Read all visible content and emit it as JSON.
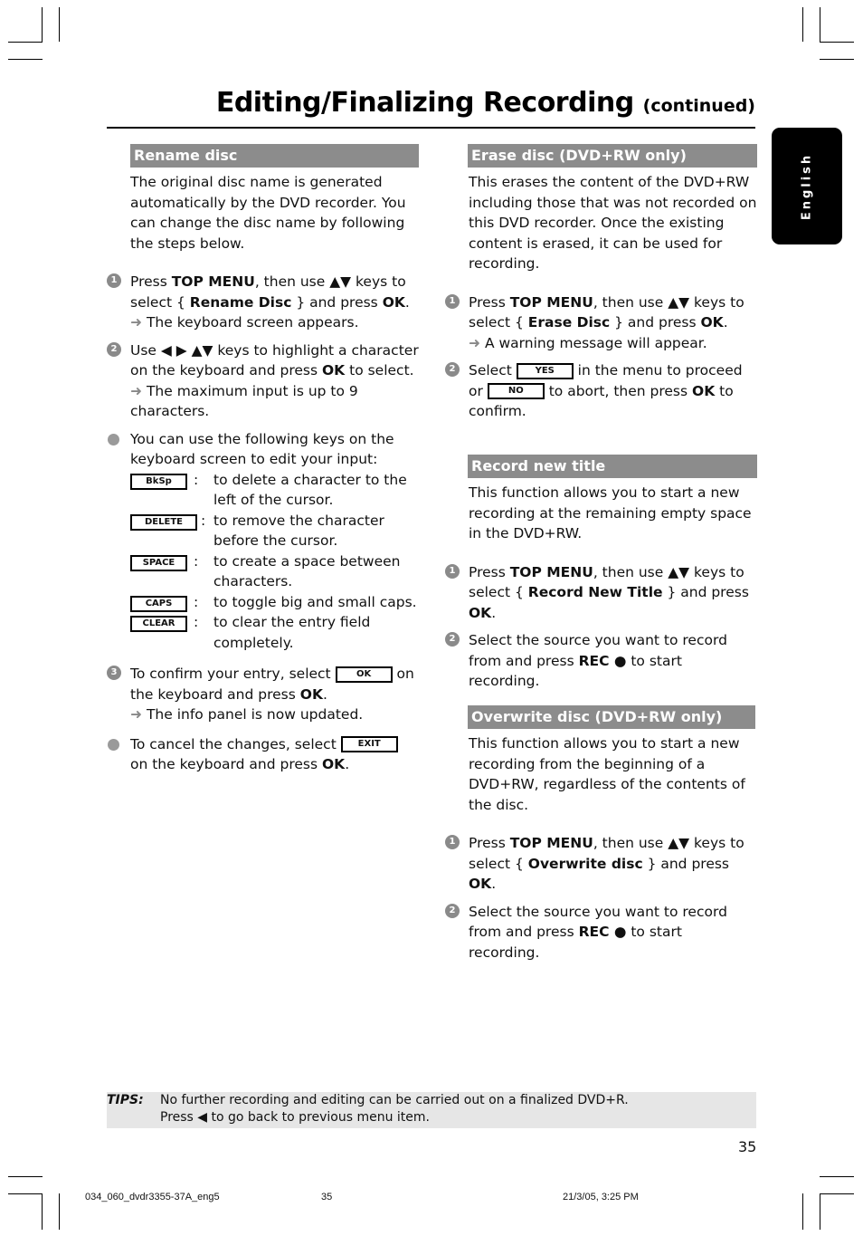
{
  "header": {
    "title": "Editing/Finalizing Recording",
    "title_suffix": "(continued)",
    "language_tab": "English"
  },
  "left_column": {
    "rename": {
      "heading": "Rename disc",
      "intro": "The original disc name is generated automatically by the DVD recorder. You can change the disc name by following the steps below.",
      "step1": {
        "num": "1",
        "pre": "Press ",
        "b1": "TOP MENU",
        "mid": ", then use ▲▼ keys to select { ",
        "b2": "Rename Disc",
        "mid2": " } and press ",
        "b3": "OK",
        "end": ".",
        "result": "The keyboard screen appears."
      },
      "step2": {
        "num": "2",
        "pre": "Use ◀ ▶ ▲▼ keys to highlight a character on the keyboard and press ",
        "b1": "OK",
        "end": " to select.",
        "result": "The maximum input is up to 9 characters."
      },
      "keys_intro": "You can use the following keys on the keyboard screen to edit your input:",
      "keys": [
        {
          "key": "BkSp",
          "desc": "to delete a character to the left of the cursor."
        },
        {
          "key": "DELETE",
          "desc": "to remove the character before the cursor."
        },
        {
          "key": "SPACE",
          "desc": "to create a space between characters."
        },
        {
          "key": "CAPS",
          "desc": "to toggle big and small caps."
        },
        {
          "key": "CLEAR",
          "desc": "to clear the entry field completely."
        }
      ],
      "step3": {
        "num": "3",
        "pre": "To confirm your entry, select ",
        "key": "OK",
        "mid": " on the keyboard and press ",
        "b1": "OK",
        "end": ".",
        "result": "The info panel is now updated."
      },
      "cancel": {
        "pre": "To cancel the changes, select ",
        "key": "EXIT",
        "mid": " on the keyboard and press ",
        "b1": "OK",
        "end": "."
      }
    }
  },
  "right_column": {
    "erase": {
      "heading": "Erase disc (DVD+RW only)",
      "intro": "This erases the content of the DVD+RW including those that was not recorded on this DVD recorder.  Once the existing content is erased, it can be used for recording.",
      "step1": {
        "num": "1",
        "pre": "Press ",
        "b1": "TOP MENU",
        "mid": ", then use ▲▼ keys to select { ",
        "b2": "Erase Disc",
        "mid2": " } and press ",
        "b3": "OK",
        "end": ".",
        "result": "A warning message will appear."
      },
      "step2": {
        "num": "2",
        "pre": "Select ",
        "key1": "YES",
        "mid": " in the menu to proceed or ",
        "key2": "NO",
        "mid2": " to abort, then press ",
        "b1": "OK",
        "end": " to confirm."
      }
    },
    "record_new": {
      "heading": "Record new title",
      "intro": "This function allows you to start a new recording at the remaining empty space in the DVD+RW.",
      "step1": {
        "num": "1",
        "pre": "Press ",
        "b1": "TOP MENU",
        "mid": ", then use ▲▼ keys to select { ",
        "b2": "Record New Title",
        "mid2": " } and press ",
        "b3": "OK",
        "end": "."
      },
      "step2": {
        "num": "2",
        "pre": "Select the source you want to record from and press ",
        "b1": "REC ●",
        "end": "  to start recording."
      }
    },
    "overwrite": {
      "heading": "Overwrite disc (DVD+RW only)",
      "intro": "This function allows you to start a new recording from the beginning of a DVD+RW, regardless of the contents of the disc.",
      "step1": {
        "num": "1",
        "pre": "Press ",
        "b1": "TOP MENU",
        "mid": ", then use ▲▼ keys to select { ",
        "b2": "Overwrite disc",
        "mid2": " } and press ",
        "b3": "OK",
        "end": "."
      },
      "step2": {
        "num": "2",
        "pre": "Select the source you want to record from and press ",
        "b1": "REC ●",
        "end": "  to start recording."
      }
    }
  },
  "tips": {
    "label": "TIPS:",
    "line1": "No further recording and editing can be carried out on a finalized DVD+R.",
    "line2": "Press ◀ to go back to previous menu item."
  },
  "page_number": "35",
  "footer": {
    "file": "034_060_dvdr3355-37A_eng5",
    "page": "35",
    "date": "21/3/05, 3:25 PM"
  },
  "icons": {
    "arrow": "➜",
    "bullet": "●"
  }
}
